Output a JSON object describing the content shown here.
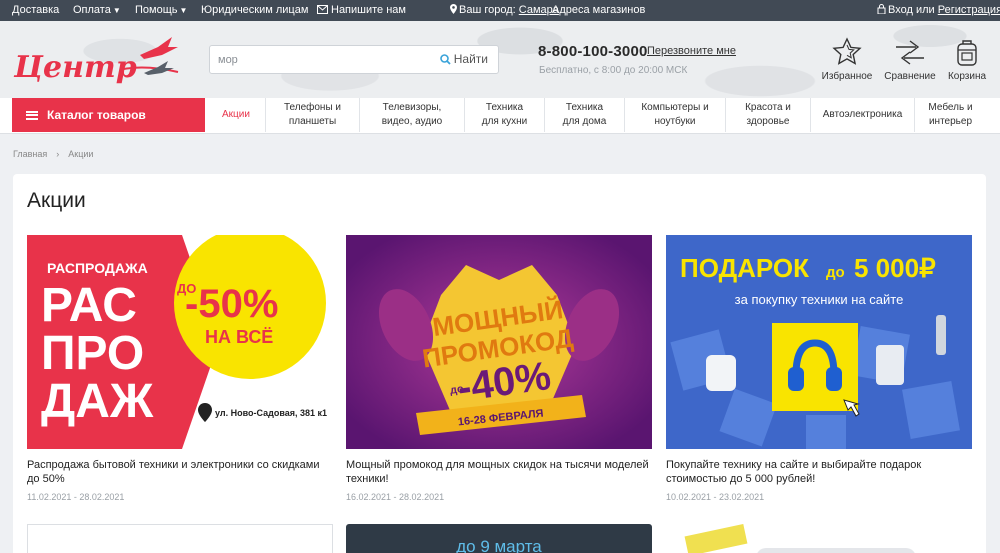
{
  "topbar": {
    "delivery": "Доставка",
    "payment": "Оплата",
    "help": "Помощь",
    "legal": "Юридическим лицам",
    "write": "Напишите нам",
    "city_label": "Ваш город:",
    "city": "Самара",
    "stores": "Адреса магазинов",
    "login": "Вход",
    "or": "или",
    "register": "Регистрация"
  },
  "logo": {
    "text": "Центр"
  },
  "search": {
    "placeholder": "мор",
    "button": "Найти"
  },
  "contact": {
    "phone": "8-800-100-3000",
    "callback": "Перезвоните мне",
    "note": "Бесплатно, с 8:00 до 20:00 МСК"
  },
  "header_icons": {
    "favorites": "Избранное",
    "compare": "Сравнение",
    "cart": "Корзина"
  },
  "nav": {
    "catalog": "Каталог товаров",
    "items": [
      {
        "l1": "Акции",
        "l2": ""
      },
      {
        "l1": "Телефоны и",
        "l2": "планшеты"
      },
      {
        "l1": "Телевизоры,",
        "l2": "видео, аудио"
      },
      {
        "l1": "Техника",
        "l2": "для кухни"
      },
      {
        "l1": "Техника",
        "l2": "для дома"
      },
      {
        "l1": "Компьютеры и",
        "l2": "ноутбуки"
      },
      {
        "l1": "Красота и",
        "l2": "здоровье"
      },
      {
        "l1": "Автоэлектроника",
        "l2": ""
      },
      {
        "l1": "Мебель и",
        "l2": "интерьер"
      }
    ]
  },
  "breadcrumb": {
    "home": "Главная",
    "sep": "›",
    "current": "Акции"
  },
  "page_title": "Акции",
  "promos": [
    {
      "title": "Распродажа бытовой техники и электроники со скидками до 50%",
      "dates": "11.02.2021 - 28.02.2021",
      "banner": {
        "small": "РАСПРОДАЖА",
        "big1": "РАС",
        "big2": "ПРО",
        "big3": "ДАЖ",
        "badge_top": "ДО",
        "badge_pct": "-50%",
        "badge_bottom": "НА ВСЁ",
        "address": "ул. Ново-Садовая, 381 к1"
      }
    },
    {
      "title": "Мощный промокод для мощных скидок на тысячи моделей техники!",
      "dates": "16.02.2021 - 28.02.2021",
      "banner": {
        "line1": "МОЩНЫЙ",
        "line2": "ПРОМОКОД",
        "pre": "до",
        "pct": "-40%",
        "ribbon": "16-28 ФЕВРАЛЯ"
      }
    },
    {
      "title": "Покупайте технику на сайте и выбирайте подарок стоимостью до 5 000 рублей!",
      "dates": "10.02.2021 - 23.02.2021",
      "banner": {
        "gift": "ПОДАРОК",
        "upto": "до",
        "amount": "5 000₽",
        "sub": "за покупку техники на сайте"
      }
    }
  ],
  "next_row": {
    "partial_text": "до 9 марта"
  },
  "colors": {
    "brand": "#e8334a",
    "topbar": "#414a55",
    "yellow": "#f9e400",
    "purple": "#7a1e86",
    "blue": "#3e67c9"
  }
}
